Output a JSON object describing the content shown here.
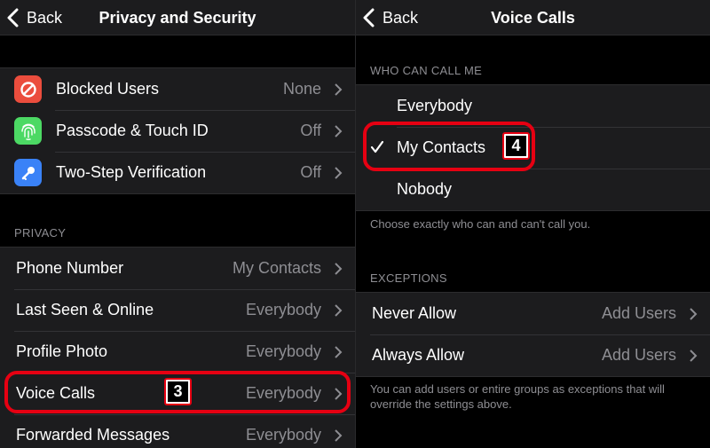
{
  "left": {
    "back_label": "Back",
    "title": "Privacy and Security",
    "security_rows": [
      {
        "label": "Blocked Users",
        "value": "None",
        "icon": "block-icon",
        "icon_color": "#eb4d3d"
      },
      {
        "label": "Passcode & Touch ID",
        "value": "Off",
        "icon": "fingerprint-icon",
        "icon_color": "#4cd964"
      },
      {
        "label": "Two-Step Verification",
        "value": "Off",
        "icon": "key-icon",
        "icon_color": "#3a82f7"
      }
    ],
    "privacy_header": "PRIVACY",
    "privacy_rows": [
      {
        "label": "Phone Number",
        "value": "My Contacts"
      },
      {
        "label": "Last Seen & Online",
        "value": "Everybody"
      },
      {
        "label": "Profile Photo",
        "value": "Everybody"
      },
      {
        "label": "Voice Calls",
        "value": "Everybody"
      },
      {
        "label": "Forwarded Messages",
        "value": "Everybody"
      }
    ],
    "step_badge": "3"
  },
  "right": {
    "back_label": "Back",
    "title": "Voice Calls",
    "who_header": "WHO CAN CALL ME",
    "options": [
      {
        "label": "Everybody",
        "selected": false
      },
      {
        "label": "My Contacts",
        "selected": true
      },
      {
        "label": "Nobody",
        "selected": false
      }
    ],
    "who_footer": "Choose exactly who can and can't call you.",
    "exceptions_header": "EXCEPTIONS",
    "exception_rows": [
      {
        "label": "Never Allow",
        "value": "Add Users"
      },
      {
        "label": "Always Allow",
        "value": "Add Users"
      }
    ],
    "exceptions_footer": "You can add users or entire groups as exceptions that will override the settings above.",
    "step_badge": "4"
  },
  "colors": {
    "highlight": "#e60012",
    "background": "#000000",
    "cell": "#1c1c1e",
    "secondary_text": "#8e8e93"
  }
}
